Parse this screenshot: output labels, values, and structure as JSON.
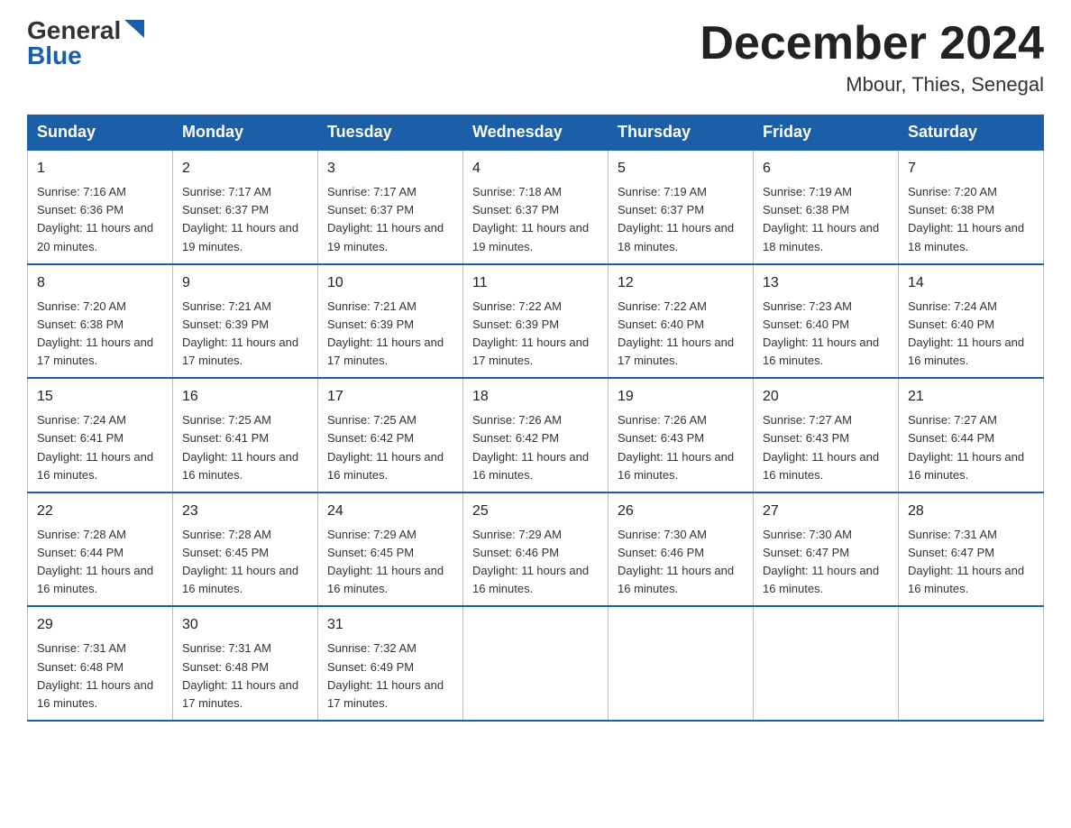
{
  "header": {
    "logo": {
      "general": "General",
      "blue": "Blue"
    },
    "title": "December 2024",
    "location": "Mbour, Thies, Senegal"
  },
  "weekdays": [
    "Sunday",
    "Monday",
    "Tuesday",
    "Wednesday",
    "Thursday",
    "Friday",
    "Saturday"
  ],
  "weeks": [
    [
      {
        "day": "1",
        "sunrise": "7:16 AM",
        "sunset": "6:36 PM",
        "daylight": "11 hours and 20 minutes."
      },
      {
        "day": "2",
        "sunrise": "7:17 AM",
        "sunset": "6:37 PM",
        "daylight": "11 hours and 19 minutes."
      },
      {
        "day": "3",
        "sunrise": "7:17 AM",
        "sunset": "6:37 PM",
        "daylight": "11 hours and 19 minutes."
      },
      {
        "day": "4",
        "sunrise": "7:18 AM",
        "sunset": "6:37 PM",
        "daylight": "11 hours and 19 minutes."
      },
      {
        "day": "5",
        "sunrise": "7:19 AM",
        "sunset": "6:37 PM",
        "daylight": "11 hours and 18 minutes."
      },
      {
        "day": "6",
        "sunrise": "7:19 AM",
        "sunset": "6:38 PM",
        "daylight": "11 hours and 18 minutes."
      },
      {
        "day": "7",
        "sunrise": "7:20 AM",
        "sunset": "6:38 PM",
        "daylight": "11 hours and 18 minutes."
      }
    ],
    [
      {
        "day": "8",
        "sunrise": "7:20 AM",
        "sunset": "6:38 PM",
        "daylight": "11 hours and 17 minutes."
      },
      {
        "day": "9",
        "sunrise": "7:21 AM",
        "sunset": "6:39 PM",
        "daylight": "11 hours and 17 minutes."
      },
      {
        "day": "10",
        "sunrise": "7:21 AM",
        "sunset": "6:39 PM",
        "daylight": "11 hours and 17 minutes."
      },
      {
        "day": "11",
        "sunrise": "7:22 AM",
        "sunset": "6:39 PM",
        "daylight": "11 hours and 17 minutes."
      },
      {
        "day": "12",
        "sunrise": "7:22 AM",
        "sunset": "6:40 PM",
        "daylight": "11 hours and 17 minutes."
      },
      {
        "day": "13",
        "sunrise": "7:23 AM",
        "sunset": "6:40 PM",
        "daylight": "11 hours and 16 minutes."
      },
      {
        "day": "14",
        "sunrise": "7:24 AM",
        "sunset": "6:40 PM",
        "daylight": "11 hours and 16 minutes."
      }
    ],
    [
      {
        "day": "15",
        "sunrise": "7:24 AM",
        "sunset": "6:41 PM",
        "daylight": "11 hours and 16 minutes."
      },
      {
        "day": "16",
        "sunrise": "7:25 AM",
        "sunset": "6:41 PM",
        "daylight": "11 hours and 16 minutes."
      },
      {
        "day": "17",
        "sunrise": "7:25 AM",
        "sunset": "6:42 PM",
        "daylight": "11 hours and 16 minutes."
      },
      {
        "day": "18",
        "sunrise": "7:26 AM",
        "sunset": "6:42 PM",
        "daylight": "11 hours and 16 minutes."
      },
      {
        "day": "19",
        "sunrise": "7:26 AM",
        "sunset": "6:43 PM",
        "daylight": "11 hours and 16 minutes."
      },
      {
        "day": "20",
        "sunrise": "7:27 AM",
        "sunset": "6:43 PM",
        "daylight": "11 hours and 16 minutes."
      },
      {
        "day": "21",
        "sunrise": "7:27 AM",
        "sunset": "6:44 PM",
        "daylight": "11 hours and 16 minutes."
      }
    ],
    [
      {
        "day": "22",
        "sunrise": "7:28 AM",
        "sunset": "6:44 PM",
        "daylight": "11 hours and 16 minutes."
      },
      {
        "day": "23",
        "sunrise": "7:28 AM",
        "sunset": "6:45 PM",
        "daylight": "11 hours and 16 minutes."
      },
      {
        "day": "24",
        "sunrise": "7:29 AM",
        "sunset": "6:45 PM",
        "daylight": "11 hours and 16 minutes."
      },
      {
        "day": "25",
        "sunrise": "7:29 AM",
        "sunset": "6:46 PM",
        "daylight": "11 hours and 16 minutes."
      },
      {
        "day": "26",
        "sunrise": "7:30 AM",
        "sunset": "6:46 PM",
        "daylight": "11 hours and 16 minutes."
      },
      {
        "day": "27",
        "sunrise": "7:30 AM",
        "sunset": "6:47 PM",
        "daylight": "11 hours and 16 minutes."
      },
      {
        "day": "28",
        "sunrise": "7:31 AM",
        "sunset": "6:47 PM",
        "daylight": "11 hours and 16 minutes."
      }
    ],
    [
      {
        "day": "29",
        "sunrise": "7:31 AM",
        "sunset": "6:48 PM",
        "daylight": "11 hours and 16 minutes."
      },
      {
        "day": "30",
        "sunrise": "7:31 AM",
        "sunset": "6:48 PM",
        "daylight": "11 hours and 17 minutes."
      },
      {
        "day": "31",
        "sunrise": "7:32 AM",
        "sunset": "6:49 PM",
        "daylight": "11 hours and 17 minutes."
      },
      null,
      null,
      null,
      null
    ]
  ],
  "labels": {
    "sunrise": "Sunrise:",
    "sunset": "Sunset:",
    "daylight": "Daylight:"
  }
}
